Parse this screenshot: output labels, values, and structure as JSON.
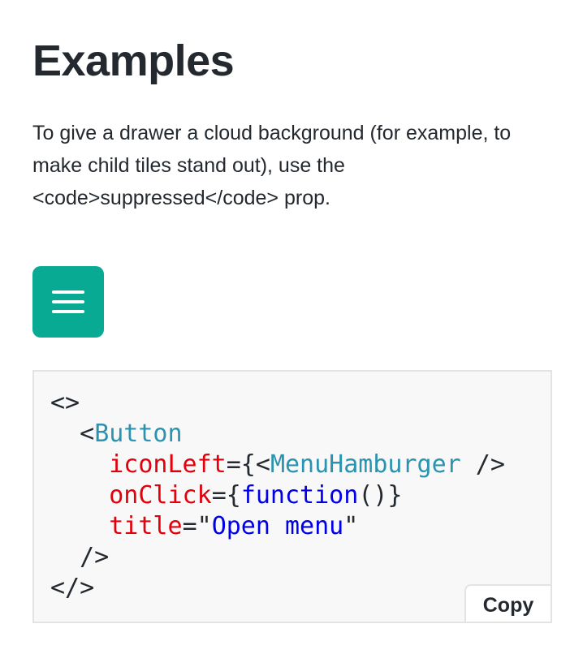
{
  "heading": "Examples",
  "description": "To give a drawer a cloud background (for example, to make child tiles stand out), use the <code>suppressed</code> prop.",
  "menu_button": {
    "icon": "menu-hamburger-icon",
    "color": "#08aa93"
  },
  "code": {
    "open_fragment": "<>",
    "button_open": "<",
    "button_tag": "Button",
    "attr_icon": "iconLeft",
    "eq_brace_lt": "={<",
    "icon_tag": "MenuHamburger",
    "self_close": " />",
    "attr_onclick": "onClick",
    "eq_brace": "={",
    "fn_keyword": "function",
    "fn_tail": "()}",
    "attr_title": "title",
    "eq_quote": "=\"",
    "title_value": "Open menu",
    "quote": "\"",
    "button_close": "/>",
    "close_fragment": "</>"
  },
  "copy_label": "Copy",
  "colors": {
    "tag": "#2a93b0",
    "attr": "#e3000b",
    "string": "#0000e6"
  }
}
